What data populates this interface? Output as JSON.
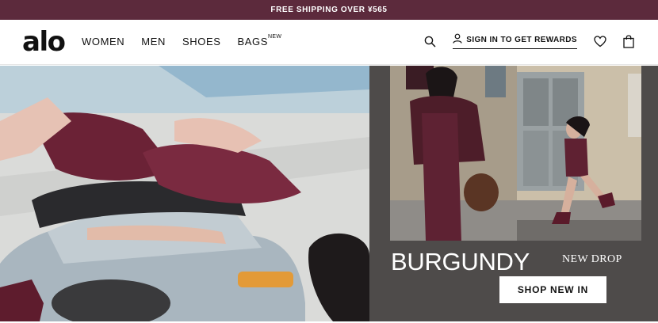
{
  "announcement": {
    "text": "FREE SHIPPING OVER ¥565"
  },
  "header": {
    "logo": "alo",
    "nav": [
      {
        "label": "WOMEN",
        "badge": ""
      },
      {
        "label": "MEN",
        "badge": ""
      },
      {
        "label": "SHOES",
        "badge": ""
      },
      {
        "label": "BAGS",
        "badge": "NEW"
      }
    ],
    "signin_label": "SIGN IN TO GET REWARDS",
    "icons": [
      "search-icon",
      "user-icon",
      "heart-icon",
      "bag-icon"
    ]
  },
  "hero": {
    "left_image": "model-lying-on-scooter-photo",
    "right_image": "model-walking-street-photo",
    "headline": "BURGUNDY",
    "tagline": "NEW DROP",
    "cta_label": "SHOP NEW IN"
  },
  "colors": {
    "announcement_bg": "#5c2a3c",
    "hero_panel_bg": "#4e4b4a",
    "burgundy": "#6e2238"
  }
}
